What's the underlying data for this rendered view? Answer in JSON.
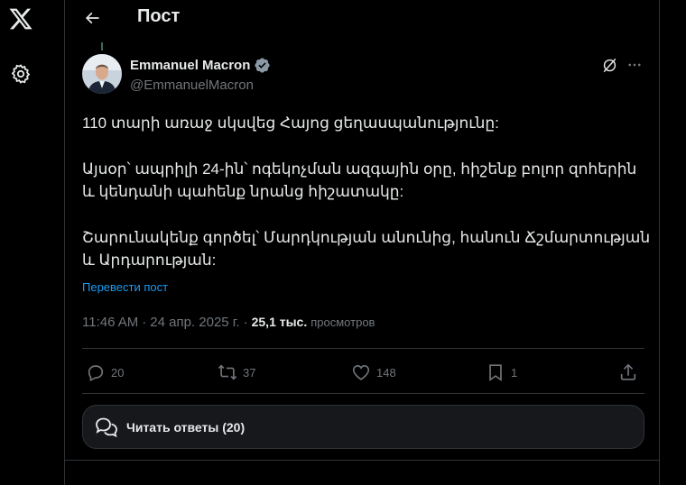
{
  "header": {
    "title": "Пост"
  },
  "author": {
    "name": "Emmanuel Macron",
    "handle": "@EmmanuelMacron"
  },
  "tweet": {
    "p1": "110 տարի առաջ սկսվեց Հայոց ցեղասպանությունը:",
    "p2": "Այսօր՝ ապրիլի 24-ին՝ ոգեկոչման ազգային օրը, հիշենք բոլոր զոհերին և կենդանի պահենք նրանց հիշատակը:",
    "p3": "Շարունակենք գործել՝ Մարդկության անունից, հանուն Ճշմարտության և Արդարության:"
  },
  "translate_label": "Перевести пост",
  "meta": {
    "time": "11:46 AM",
    "sep1": "·",
    "date": "24 апр. 2025 г.",
    "sep2": "·",
    "views_count": "25,1 тыс.",
    "views_label": "просмотров"
  },
  "actions": {
    "replies": "20",
    "reposts": "37",
    "likes": "148",
    "bookmarks": "1"
  },
  "read_replies": "Читать ответы (20)",
  "icons": [
    "x-logo-icon",
    "gear-icon",
    "back-arrow-icon",
    "verified-badge-icon",
    "grok-icon",
    "more-icon",
    "reply-icon",
    "repost-icon",
    "like-icon",
    "bookmark-icon",
    "share-icon",
    "chat-bubbles-icon"
  ],
  "colors": {
    "accent": "#1d9bf0",
    "text": "#e7e9ea",
    "muted": "#71767b",
    "border": "#2f3336"
  }
}
